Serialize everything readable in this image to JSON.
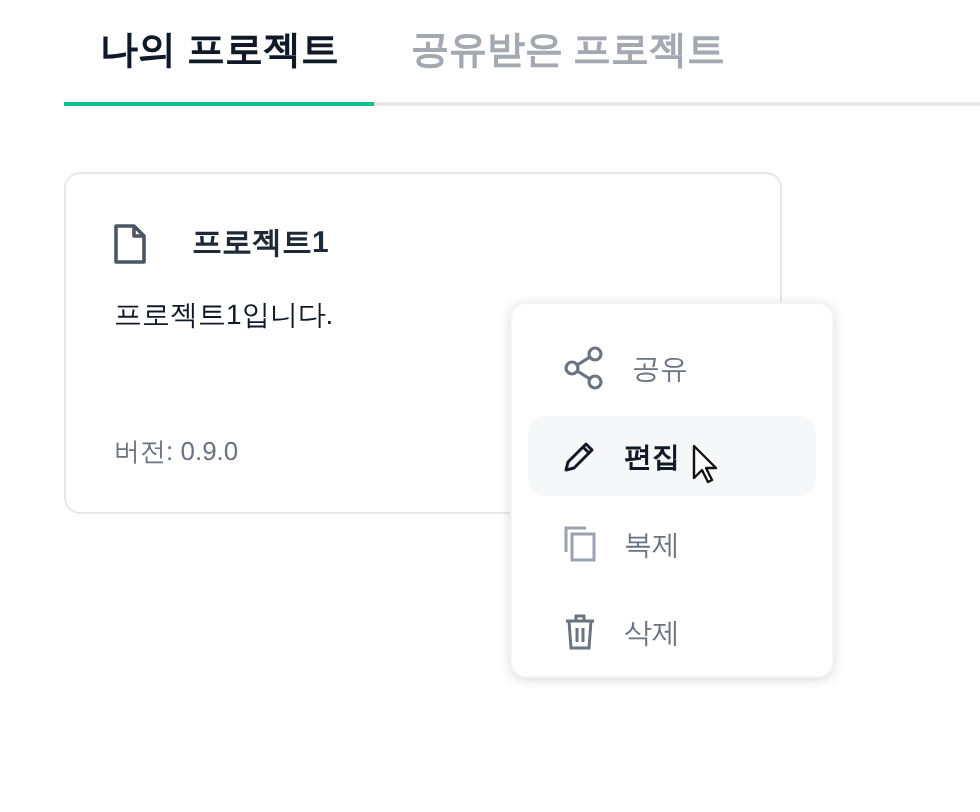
{
  "tabs": [
    {
      "label": "나의 프로젝트",
      "selected": true
    },
    {
      "label": "공유받은 프로젝트",
      "selected": false
    }
  ],
  "project_card": {
    "title": "프로젝트1",
    "description": "프로젝트1입니다.",
    "version": "버전: 0.9.0"
  },
  "context_menu": {
    "items": [
      {
        "kind": "share",
        "label": "공유",
        "selected": false
      },
      {
        "kind": "edit",
        "label": "편집",
        "selected": true
      },
      {
        "kind": "copy",
        "label": "복제",
        "selected": false
      },
      {
        "kind": "delete",
        "label": "삭제",
        "selected": false
      }
    ]
  }
}
